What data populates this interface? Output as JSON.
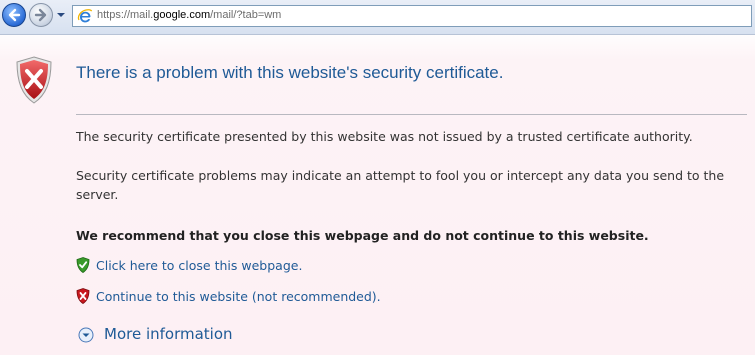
{
  "toolbar": {
    "url_prefix": "https://mail.",
    "url_domain": "google.com",
    "url_suffix": "/mail/?tab=wm",
    "back_icon": "back-arrow-icon",
    "forward_icon": "forward-arrow-icon"
  },
  "page": {
    "title": "There is a problem with this website's security certificate.",
    "paragraph1": "The security certificate presented by this website was not issued by a trusted certificate authority.",
    "paragraph2": "Security certificate problems may indicate an attempt to fool you or intercept any data you send to the server.",
    "recommendation": "We recommend that you close this webpage and do not continue to this website.",
    "close_link": "Click here to close this webpage.",
    "continue_link": "Continue to this website (not recommended).",
    "more_info": "More information"
  },
  "colors": {
    "link": "#1f5a96",
    "shield_red": "#c8181e",
    "shield_green": "#3a9a2a"
  }
}
